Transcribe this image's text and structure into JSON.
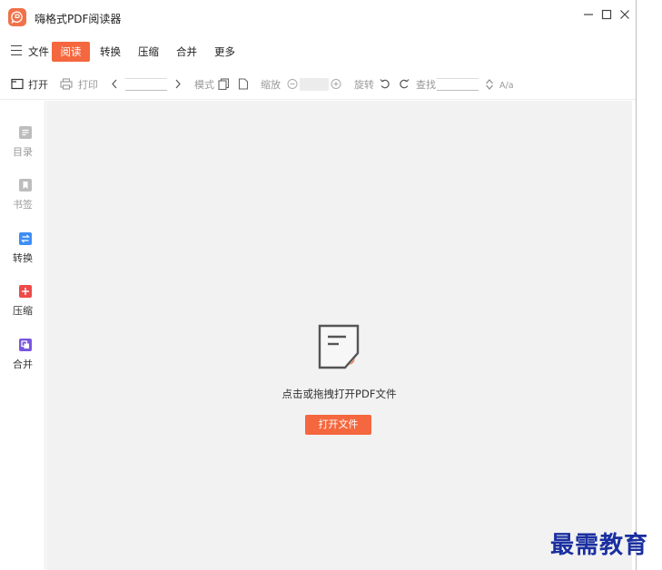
{
  "app": {
    "title": "嗨格式PDF阅读器"
  },
  "menu": {
    "items": [
      {
        "label": "文件"
      },
      {
        "label": "阅读",
        "active": true
      },
      {
        "label": "转换"
      },
      {
        "label": "压缩"
      },
      {
        "label": "合并"
      },
      {
        "label": "更多"
      }
    ]
  },
  "toolbar": {
    "open_label": "打开",
    "print_label": "打印",
    "mode_label": "模式",
    "zoom_label": "缩放",
    "rotate_label": "旋转",
    "find_label": "查找",
    "case_label": "A/a",
    "page_value": "",
    "zoom_value": "",
    "find_value": ""
  },
  "sidebar": {
    "items": [
      {
        "label": "目录",
        "icon": "toc-icon",
        "color": "#b9b9b9"
      },
      {
        "label": "书签",
        "icon": "bookmark-icon",
        "color": "#b9b9b9"
      },
      {
        "label": "转换",
        "icon": "convert-icon",
        "color": "#3d8ef5"
      },
      {
        "label": "压缩",
        "icon": "compress-icon",
        "color": "#ef4a4a"
      },
      {
        "label": "合并",
        "icon": "merge-icon",
        "color": "#7a56e0"
      }
    ]
  },
  "main": {
    "hint": "点击或拖拽打开PDF文件",
    "open_button": "打开文件"
  },
  "colors": {
    "accent": "#f5673e"
  },
  "watermark": "最需教育"
}
